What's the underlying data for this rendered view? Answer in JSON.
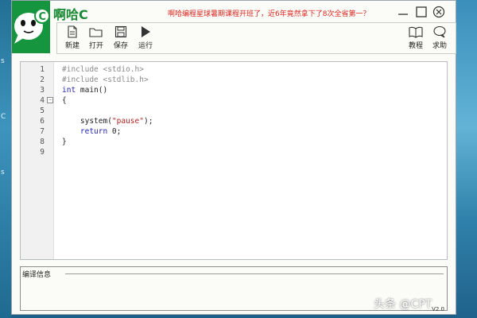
{
  "app": {
    "title": "啊哈C",
    "banner": "啊哈编程星球暑期课程开班了，近6年竟然拿下了8次全省第一？"
  },
  "toolbar": {
    "new_label": "新建",
    "open_label": "打开",
    "save_label": "保存",
    "run_label": "运行",
    "tutorial_label": "教程",
    "help_label": "求助"
  },
  "editor": {
    "lines": [
      {
        "num": "1",
        "text": "#include <stdio.h>"
      },
      {
        "num": "2",
        "text": "#include <stdlib.h>"
      },
      {
        "num": "3",
        "kw": "int",
        "text": " main()"
      },
      {
        "num": "4",
        "text": "{"
      },
      {
        "num": "5",
        "text": ""
      },
      {
        "num": "6",
        "pre": "    system(",
        "str": "\"pause\"",
        "post": ");"
      },
      {
        "num": "7",
        "kw": "    return",
        "text": " 0;"
      },
      {
        "num": "8",
        "text": "}"
      },
      {
        "num": "9",
        "text": ""
      }
    ]
  },
  "output": {
    "label": "编译信息",
    "version": "V2.0"
  },
  "desktop": {
    "left_glyphs": [
      "s",
      "C",
      "s"
    ]
  },
  "watermark": "头条 @CPT"
}
